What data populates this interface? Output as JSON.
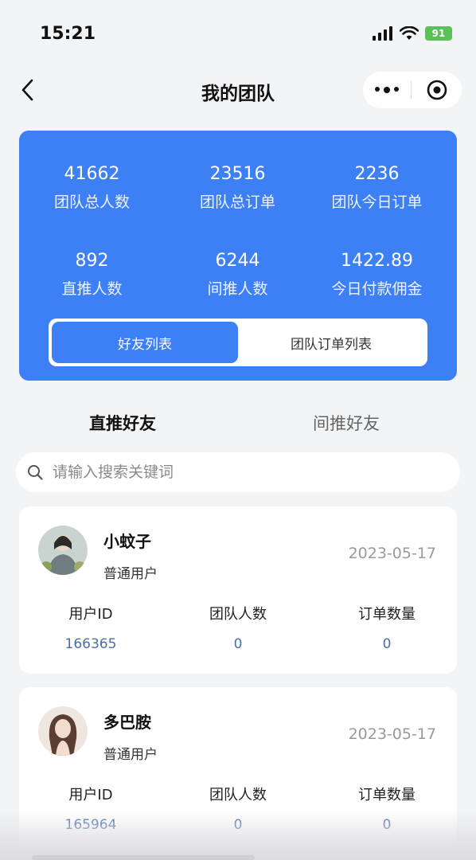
{
  "status_bar": {
    "time": "15:21",
    "battery": "91"
  },
  "nav": {
    "title": "我的团队"
  },
  "stats": [
    {
      "value": "41662",
      "label": "团队总人数"
    },
    {
      "value": "23516",
      "label": "团队总订单"
    },
    {
      "value": "2236",
      "label": "团队今日订单"
    },
    {
      "value": "892",
      "label": "直推人数"
    },
    {
      "value": "6244",
      "label": "间推人数"
    },
    {
      "value": "1422.89",
      "label": "今日付款佣金"
    }
  ],
  "segments": {
    "active": "好友列表",
    "inactive": "团队订单列表"
  },
  "tabs": {
    "active": "直推好友",
    "inactive": "间推好友"
  },
  "search": {
    "placeholder": "请输入搜索关键词"
  },
  "users": [
    {
      "name": "小蚊子",
      "role": "普通用户",
      "date": "2023-05-17",
      "col_labels": [
        "用户ID",
        "团队人数",
        "订单数量"
      ],
      "col_values": [
        "166365",
        "0",
        "0"
      ]
    },
    {
      "name": "多巴胺",
      "role": "普通用户",
      "date": "2023-05-17",
      "col_labels": [
        "用户ID",
        "团队人数",
        "订单数量"
      ],
      "col_values": [
        "165964",
        "0",
        "0"
      ]
    }
  ],
  "colors": {
    "accent": "#3d7ff5",
    "id_text": "#4a6ea8"
  }
}
